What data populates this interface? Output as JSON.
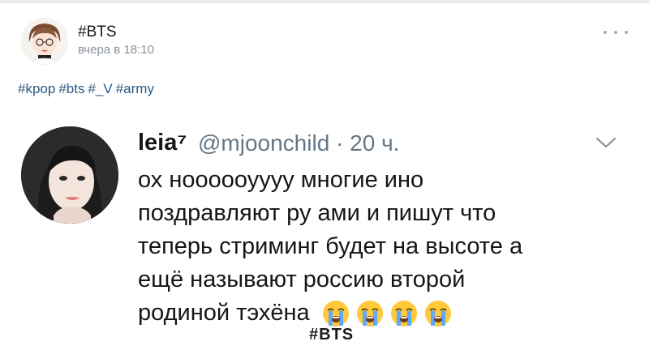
{
  "post": {
    "community_name": "#BTS",
    "time": "вчера в 18:10",
    "tags": [
      "#kpop",
      "#bts",
      "#_V",
      "#army"
    ]
  },
  "tweet": {
    "author": "leia⁷",
    "handle_time": "@mjoonchild · 20 ч.",
    "lines": [
      "ох ноооооуууу многие ино",
      "поздравляют ру ами и пишут что",
      "теперь стриминг будет на высоте а",
      "ещё называют россию второй",
      "родиной тэхёна"
    ],
    "emoji_count": 4
  },
  "watermark": "#BTS",
  "colors": {
    "link": "#2a5885",
    "secondary_text": "#8a929c",
    "tweet_handle": "#657786",
    "emoji_face": "#ffc93a",
    "emoji_tears": "#5fa8ff"
  },
  "icons": {
    "more": "three-dots-icon",
    "tweet_menu": "chevron-down-icon",
    "emoji": "loudly-crying-face-emoji"
  }
}
